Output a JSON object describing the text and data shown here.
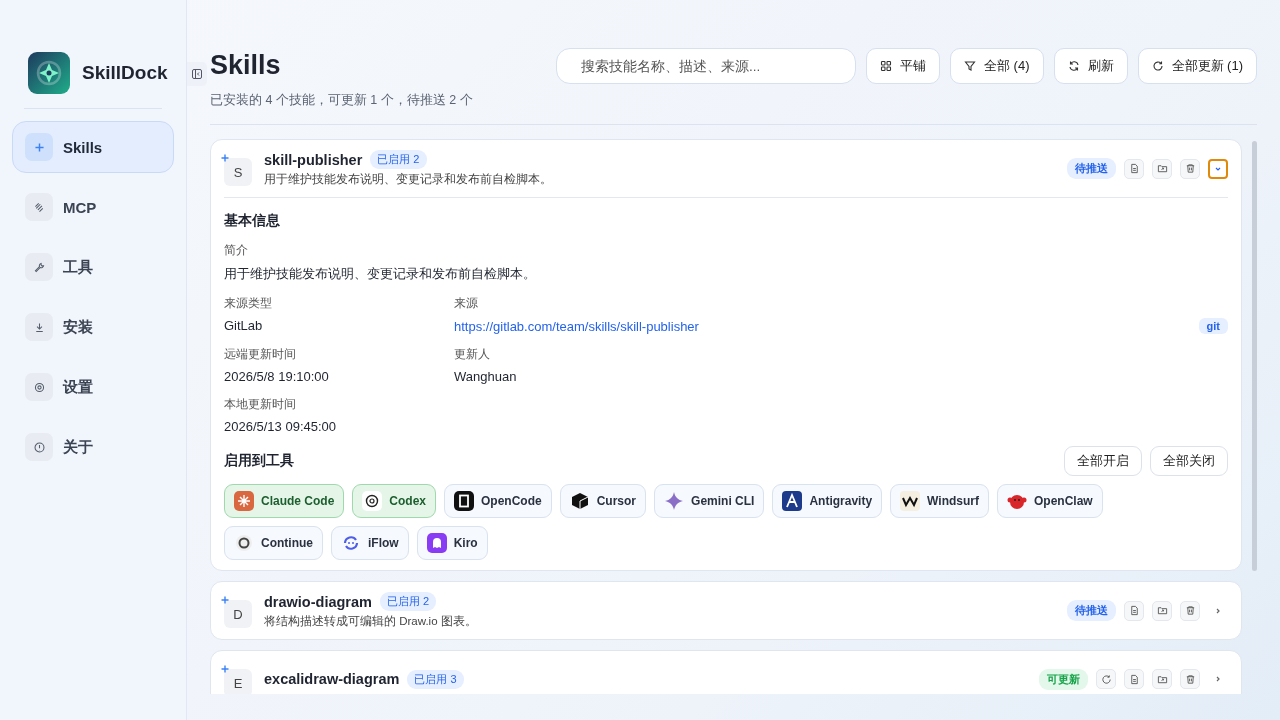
{
  "sidebar": {
    "app_name": "SkillDock",
    "items": [
      {
        "label": "Skills",
        "selected": true
      },
      {
        "label": "MCP",
        "selected": false
      },
      {
        "label": "工具",
        "selected": false
      },
      {
        "label": "安装",
        "selected": false
      },
      {
        "label": "设置",
        "selected": false
      },
      {
        "label": "关于",
        "selected": false
      }
    ]
  },
  "header": {
    "title": "Skills",
    "subtitle": "已安装的 4 个技能，可更新 1 个，待推送 2 个"
  },
  "toolbar": {
    "search": {
      "placeholder": "搜索技能名称、描述、来源..."
    },
    "buttons": [
      "平铺",
      "全部 (4)",
      "刷新",
      "全部更新 (1)"
    ]
  },
  "skills": [
    {
      "letter": "S",
      "name": "skill-publisher",
      "enabled_badge": "已启用 2",
      "description": "用于维护技能发布说明、变更记录和发布前自检脚本。",
      "status": {
        "kind": "push",
        "label": "待推送"
      },
      "can_update": false,
      "expanded": true,
      "details": {
        "section_title": "基本信息",
        "summary_label": "简介",
        "summary": "用于维护技能发布说明、变更记录和发布前自检脚本。",
        "fields": [
          {
            "label": "来源类型",
            "value": "GitLab",
            "kind": "text"
          },
          {
            "label": "来源",
            "value": "https://gitlab.com/team/skills/skill-publisher",
            "kind": "link",
            "tag": "git"
          },
          {
            "label": "远端更新时间",
            "value": "2026/5/8 19:10:00",
            "kind": "text"
          },
          {
            "label": "更新人",
            "value": "Wanghuan",
            "kind": "text"
          },
          {
            "label": "本地更新时间",
            "value": "2026/5/13 09:45:00",
            "kind": "text"
          }
        ],
        "tools_title": "启用到工具",
        "tools_buttons": [
          "全部开启",
          "全部关闭"
        ],
        "tools": [
          {
            "label": "Claude Code",
            "enabled": true
          },
          {
            "label": "Codex",
            "enabled": true
          },
          {
            "label": "OpenCode",
            "enabled": false
          },
          {
            "label": "Cursor",
            "enabled": false
          },
          {
            "label": "Gemini CLI",
            "enabled": false
          },
          {
            "label": "Antigravity",
            "enabled": false
          },
          {
            "label": "Windsurf",
            "enabled": false
          },
          {
            "label": "OpenClaw",
            "enabled": false
          },
          {
            "label": "Continue",
            "enabled": false
          },
          {
            "label": "iFlow",
            "enabled": false
          },
          {
            "label": "Kiro",
            "enabled": false
          }
        ]
      }
    },
    {
      "letter": "D",
      "name": "drawio-diagram",
      "enabled_badge": "已启用 2",
      "description": "将结构描述转成可编辑的 Draw.io 图表。",
      "status": {
        "kind": "push",
        "label": "待推送"
      },
      "can_update": false,
      "expanded": false
    },
    {
      "letter": "E",
      "name": "excalidraw-diagram",
      "enabled_badge": "已启用 3",
      "status": {
        "kind": "update",
        "label": "可更新"
      },
      "can_update": true,
      "expanded": false
    }
  ]
}
